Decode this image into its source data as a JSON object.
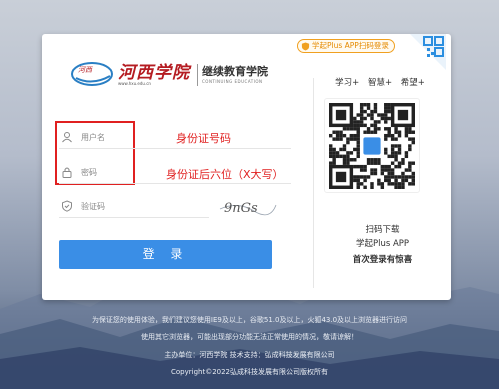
{
  "logo": {
    "school_name": "河西学院",
    "college_name": "继续教育学院",
    "english_name": "CONTINUING EDUCATION",
    "url": "www.hxu.edu.cn"
  },
  "form": {
    "username_placeholder": "用户名",
    "password_placeholder": "密码",
    "captcha_placeholder": "验证码",
    "captcha_text": "9nGs",
    "login_label": "登 录"
  },
  "annotations": {
    "username_hint": "身份证号码",
    "password_hint": "身份证后六位（X大写）"
  },
  "right_panel": {
    "app_badge": "学起Plus APP扫码登录",
    "slogans": [
      "学习+",
      "智慧+",
      "希望+"
    ],
    "scan_download": "扫码下载",
    "app_name": "学起Plus APP",
    "first_login": "首次登录有惊喜"
  },
  "footer": {
    "line1": "为保证您的使用体验，我们建议您使用IE9及以上，谷歌51.0及以上，火狐43.0及以上浏览器进行访问",
    "line2": "使用其它浏览器，可能出现部分功能无法正常使用的情况，敬请谅解！",
    "line3": "主办单位：河西学院  技术支持：弘成科技发展有限公司",
    "line4": "Copyright©2022弘成科技发展有限公司版权所有"
  },
  "colors": {
    "primary": "#3a8ee6",
    "annotation_red": "#e02020",
    "badge_orange": "#e58a00",
    "logo_red": "#b51c22"
  },
  "icons": [
    "user-icon",
    "lock-icon",
    "shield-check-icon",
    "qr-code-icon"
  ]
}
